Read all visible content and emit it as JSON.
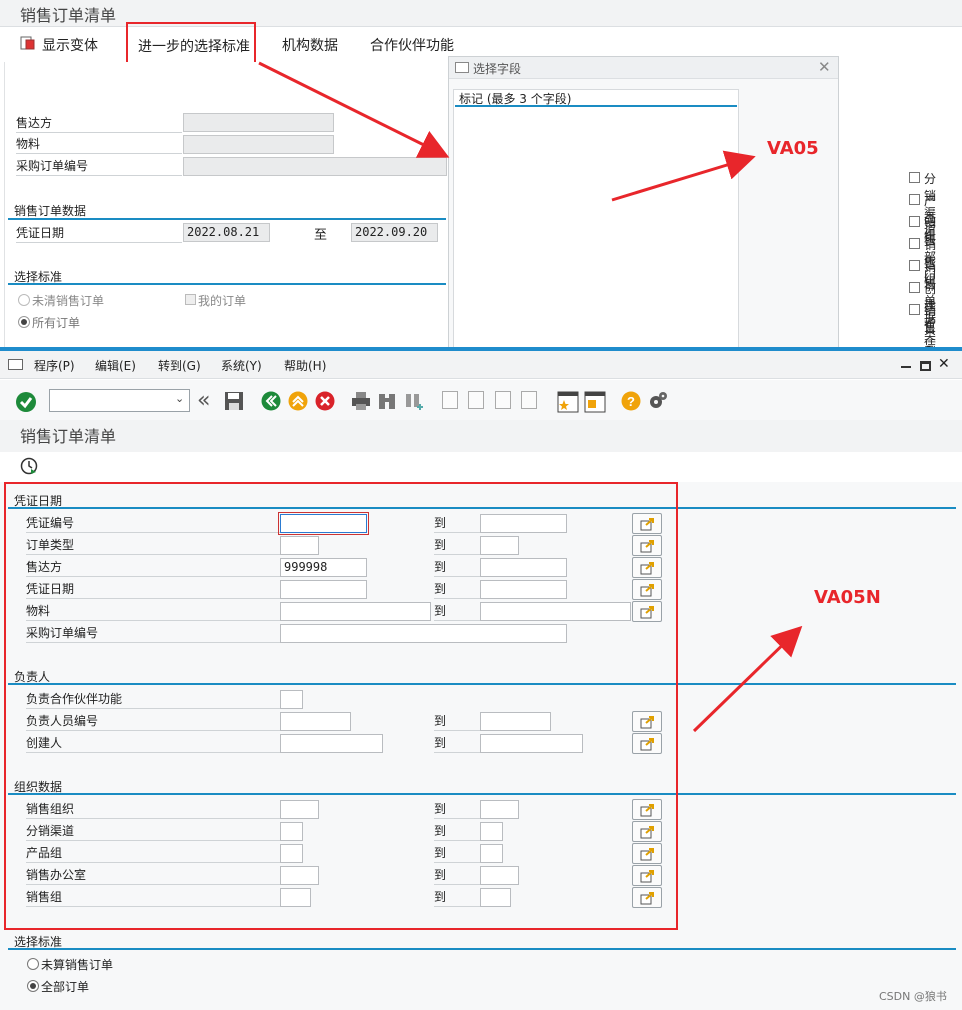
{
  "top": {
    "title": "销售订单清单",
    "toolbar": {
      "show_variant": "显示变体",
      "further_selection": "进一步的选择标准",
      "org_data": "机构数据",
      "partner_function": "合作伙伴功能"
    },
    "fields": {
      "sold_to": "售达方",
      "material": "物料",
      "po_number": "采购订单编号"
    },
    "sales_order_data": {
      "title": "销售订单数据",
      "doc_date_label": "凭证日期",
      "date_from": "2022.08.21",
      "to_label": "至",
      "date_to": "2022.09.20"
    },
    "selection": {
      "title": "选择标准",
      "open_orders": "未清销售订单",
      "my_orders": "我的订单",
      "all_orders": "所有订单"
    }
  },
  "popup": {
    "title": "选择字段",
    "subtitle": "标记 (最多 3 个字段)",
    "items": [
      "分销渠道",
      "产品组",
      "销售部门",
      "销售组",
      "销售单据类型",
      "创建者",
      "销售凭证"
    ]
  },
  "annotations": {
    "va05": "VA05",
    "va05n": "VA05N",
    "arrow_color": "#e8262b"
  },
  "menu": {
    "program": "程序(P)",
    "edit": "编辑(E)",
    "goto": "转到(G)",
    "system": "系统(Y)",
    "help": "帮助(H)"
  },
  "bottom": {
    "title": "销售订单清单",
    "doc_date_section": {
      "title": "凭证日期",
      "rows": [
        {
          "label": "凭证编号",
          "from": "",
          "to_label": "到",
          "to": ""
        },
        {
          "label": "订单类型",
          "from": "",
          "to_label": "到",
          "to": ""
        },
        {
          "label": "售达方",
          "from": "999998",
          "to_label": "到",
          "to": ""
        },
        {
          "label": "凭证日期",
          "from": "",
          "to_label": "到",
          "to": ""
        },
        {
          "label": "物料",
          "from": "",
          "to_label": "到",
          "to": ""
        },
        {
          "label": "采购订单编号",
          "from": ""
        }
      ]
    },
    "responsible_section": {
      "title": "负责人",
      "rows": [
        {
          "label": "负责合作伙伴功能",
          "from": ""
        },
        {
          "label": "负责人员编号",
          "from": "",
          "to_label": "到",
          "to": ""
        },
        {
          "label": "创建人",
          "from": "",
          "to_label": "到",
          "to": ""
        }
      ]
    },
    "org_section": {
      "title": "组织数据",
      "rows": [
        {
          "label": "销售组织",
          "to_label": "到"
        },
        {
          "label": "分销渠道",
          "to_label": "到"
        },
        {
          "label": "产品组",
          "to_label": "到"
        },
        {
          "label": "销售办公室",
          "to_label": "到"
        },
        {
          "label": "销售组",
          "to_label": "到"
        }
      ]
    },
    "selection": {
      "title": "选择标准",
      "open_orders": "未算销售订单",
      "all_orders": "全部订单"
    }
  },
  "watermark": "CSDN @狼书"
}
